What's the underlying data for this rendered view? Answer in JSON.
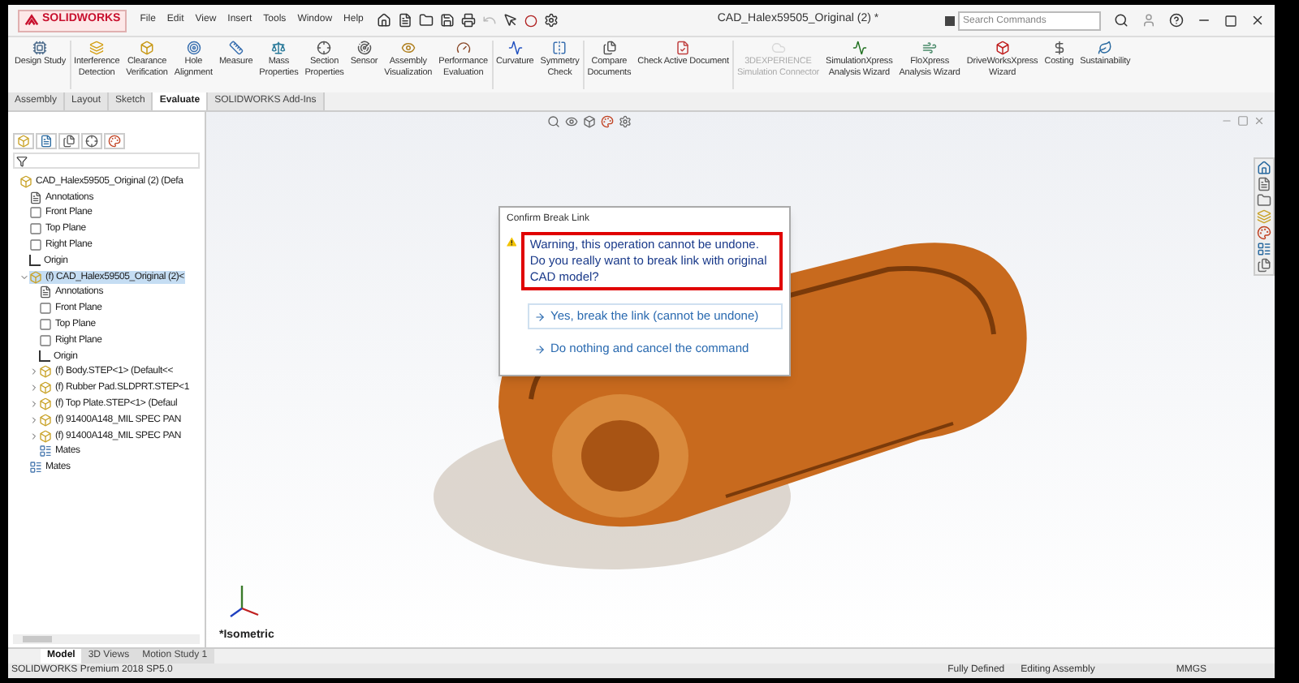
{
  "title_bar": {
    "logo": "SOLIDWORKS",
    "menu": [
      "File",
      "Edit",
      "View",
      "Insert",
      "Tools",
      "Window",
      "Help"
    ],
    "title": "CAD_Halex59505_Original (2) *",
    "search": {
      "placeholder": "Search Commands"
    }
  },
  "ribbon": [
    [
      {
        "label": [
          "Design Study"
        ],
        "disabled": false
      }
    ],
    [
      {
        "label": [
          "Interference",
          "Detection"
        ],
        "disabled": false
      },
      {
        "label": [
          "Clearance",
          "Verification"
        ],
        "disabled": false
      },
      {
        "label": [
          "Hole",
          "Alignment"
        ],
        "disabled": false
      },
      {
        "label": [
          "Measure"
        ],
        "disabled": false
      },
      {
        "label": [
          "Mass",
          "Properties"
        ],
        "disabled": false
      },
      {
        "label": [
          "Section",
          "Properties"
        ],
        "disabled": false
      },
      {
        "label": [
          "Sensor"
        ],
        "disabled": false
      },
      {
        "label": [
          "Assembly",
          "Visualization"
        ],
        "disabled": false
      },
      {
        "label": [
          "Performance",
          "Evaluation"
        ],
        "disabled": false
      }
    ],
    [
      {
        "label": [
          "Curvature"
        ],
        "disabled": false
      },
      {
        "label": [
          "Symmetry",
          "Check"
        ],
        "disabled": false
      }
    ],
    [
      {
        "label": [
          "Compare",
          "Documents"
        ],
        "disabled": false
      },
      {
        "label": [
          "Check Active Document"
        ],
        "disabled": false
      }
    ],
    [
      {
        "label": [
          "3DEXPERIENCE",
          "Simulation Connector"
        ],
        "disabled": true
      },
      {
        "label": [
          "SimulationXpress",
          "Analysis Wizard"
        ],
        "disabled": false
      },
      {
        "label": [
          "FloXpress",
          "Analysis Wizard"
        ],
        "disabled": false
      },
      {
        "label": [
          "DriveWorksXpress",
          "Wizard"
        ],
        "disabled": false
      },
      {
        "label": [
          "Costing"
        ],
        "disabled": false
      },
      {
        "label": [
          "Sustainability"
        ],
        "disabled": false
      }
    ]
  ],
  "tabs": [
    {
      "label": "Assembly",
      "selected": false
    },
    {
      "label": "Layout",
      "selected": false
    },
    {
      "label": "Sketch",
      "selected": false
    },
    {
      "label": "Evaluate",
      "selected": true
    },
    {
      "label": "SOLIDWORKS Add-Ins",
      "selected": false
    }
  ],
  "tree": [
    {
      "label": "CAD_Halex59505_Original (2)  (Defa",
      "kind": "assembly",
      "selected": false,
      "children": [
        {
          "label": "Annotations",
          "kind": "annotations",
          "selected": false
        },
        {
          "label": "Front Plane",
          "kind": "plane",
          "selected": false
        },
        {
          "label": "Top Plane",
          "kind": "plane",
          "selected": false
        },
        {
          "label": "Right Plane",
          "kind": "plane",
          "selected": false
        },
        {
          "label": "Origin",
          "kind": "origin",
          "selected": false
        },
        {
          "label": "(f) CAD_Halex59505_Original (2)<",
          "kind": "assembly",
          "selected": true,
          "expanded": true,
          "children": [
            {
              "label": "Annotations",
              "kind": "annotations",
              "selected": false
            },
            {
              "label": "Front Plane",
              "kind": "plane",
              "selected": false
            },
            {
              "label": "Top Plane",
              "kind": "plane",
              "selected": false
            },
            {
              "label": "Right Plane",
              "kind": "plane",
              "selected": false
            },
            {
              "label": "Origin",
              "kind": "origin",
              "selected": false
            },
            {
              "label": "(f) Body.STEP<1> (Default<<",
              "kind": "part",
              "selected": false,
              "expanded": false
            },
            {
              "label": "(f) Rubber Pad.SLDPRT.STEP<1",
              "kind": "part",
              "selected": false,
              "expanded": false
            },
            {
              "label": "(f) Top Plate.STEP<1> (Defaul",
              "kind": "part",
              "selected": false,
              "expanded": false
            },
            {
              "label": "(f) 91400A148_MIL SPEC PAN",
              "kind": "part",
              "selected": false,
              "expanded": false
            },
            {
              "label": "(f) 91400A148_MIL SPEC PAN",
              "kind": "part",
              "selected": false,
              "expanded": false
            },
            {
              "label": "Mates",
              "kind": "mates",
              "selected": false
            }
          ]
        },
        {
          "label": "Mates",
          "kind": "mates",
          "selected": false
        }
      ]
    }
  ],
  "dialog": {
    "title": "Confirm Break Link",
    "warning": "Warning, this operation cannot be undone. Do you really want to break link with original CAD model?",
    "options": [
      {
        "label": "Yes, break the link (cannot be undone)",
        "selected": true
      },
      {
        "label": "Do nothing and cancel the command",
        "selected": false
      }
    ]
  },
  "view_label": "*Isometric",
  "bottom_tabs": [
    {
      "label": "Model",
      "selected": true
    },
    {
      "label": "3D Views",
      "selected": false
    },
    {
      "label": "Motion Study 1",
      "selected": false
    }
  ],
  "status_bar": {
    "product": "SOLIDWORKS Premium 2018 SP5.0",
    "state": "Fully Defined",
    "mode": "Editing Assembly",
    "units": "MMGS"
  }
}
